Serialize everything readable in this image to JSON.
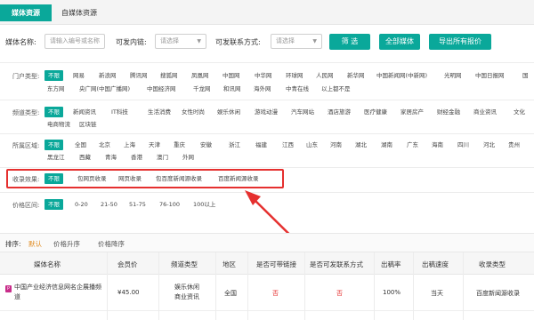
{
  "tabs": {
    "active": "媒体资源",
    "other": "自媒体资源"
  },
  "search": {
    "name_label": "媒体名称:",
    "name_placeholder": "请输入编号或名称",
    "can_publish_label": "可发内链:",
    "can_publish_value": "请选择",
    "contact_label": "可发联系方式:",
    "contact_value": "请选择",
    "filter_btn": "筛 选",
    "all_btn": "全部媒体",
    "export_btn": "导出所有报价"
  },
  "portal": {
    "label": "门户类型:",
    "row1": [
      "不限",
      "网易",
      "新浪网",
      "腾讯网",
      "搜狐网",
      "凤凰网",
      "中国网",
      "中华网",
      "环球网",
      "人民网",
      "新华网",
      "中国新闻网(中新网)",
      "光明网",
      "中国日报网",
      "国"
    ],
    "row2": [
      "东方网",
      "央广网(中国广播网)",
      "中国经济网",
      "千龙网",
      "和讯网",
      "海外网",
      "中青在线",
      "以上都不是"
    ]
  },
  "channel": {
    "label": "频道类型:",
    "row1": [
      "不限",
      "新闻资讯",
      "IT科技",
      "生活消费",
      "女性时尚",
      "娱乐休闲",
      "游戏动漫",
      "汽车网站",
      "酒店旅游",
      "医疗健康",
      "家居房产",
      "财经金融",
      "商业资讯",
      "文化"
    ],
    "row2": [
      "电商物流",
      "区块链"
    ]
  },
  "region": {
    "label": "所属区域:",
    "row1": [
      "不限",
      "全国",
      "北京",
      "上海",
      "天津",
      "重庆",
      "安徽",
      "浙江",
      "福建",
      "江西",
      "山东",
      "河南",
      "湖北",
      "湖南",
      "广东",
      "海南",
      "四川",
      "河北",
      "贵州"
    ],
    "row2": [
      "黑龙江",
      "西藏",
      "青海",
      "香港",
      "澳门",
      "外网"
    ]
  },
  "indexing": {
    "label": "收录效果:",
    "items": [
      "不限",
      "包网页收录",
      "网页收录",
      "包百度新闻源收录",
      "百度新闻源收录"
    ]
  },
  "price": {
    "label": "价格区间:",
    "items": [
      "不限",
      "0-20",
      "21-50",
      "51-75",
      "76-100",
      "100以上"
    ]
  },
  "sort": {
    "label": "排序:",
    "default": "默认",
    "price_asc": "价格升序",
    "price_desc": "价格降序"
  },
  "table": {
    "headers": [
      "媒体名称",
      "会员价",
      "频道类型",
      "地区",
      "是否可带链接",
      "是否可发联系方式",
      "出稿率",
      "出稿速度",
      "收录类型"
    ],
    "rows": [
      {
        "name": "中国产业经济信息网名企展播频道",
        "price": "¥45.00",
        "channel": "娱乐休闲 商业资讯",
        "region": "全国",
        "link": "否",
        "contact": "否",
        "rate": "100%",
        "speed": "当天",
        "index": "百度新闻源收录"
      }
    ]
  },
  "colors": {
    "accent": "#0aa89a",
    "highlight": "#e5302f"
  }
}
